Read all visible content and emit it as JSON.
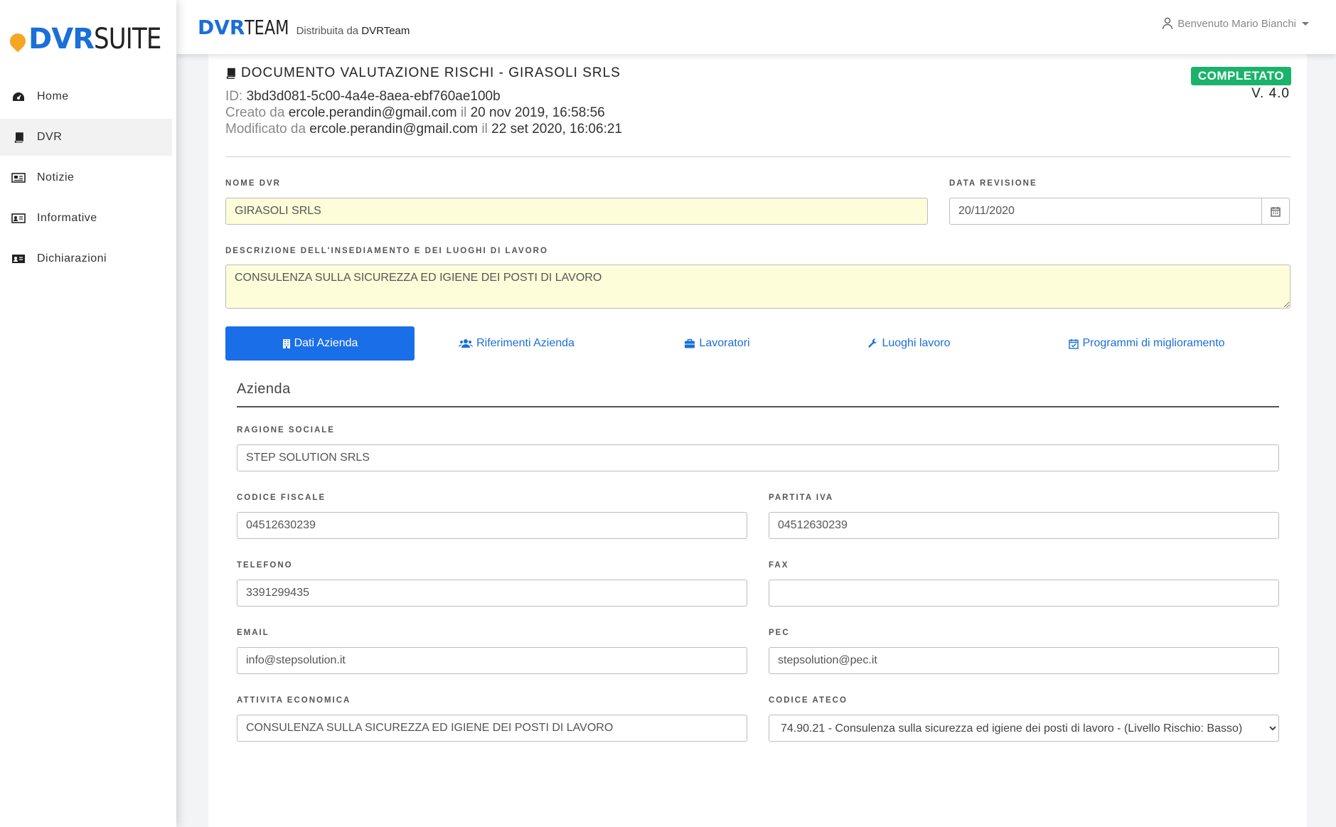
{
  "sidebar": {
    "logo": {
      "dvr": "DVR",
      "suite": "SUITE"
    },
    "items": [
      {
        "label": "Home",
        "icon": "dashboard-icon"
      },
      {
        "label": "DVR",
        "icon": "book-icon",
        "active": true
      },
      {
        "label": "Notizie",
        "icon": "newspaper-icon"
      },
      {
        "label": "Informative",
        "icon": "id-card-icon"
      },
      {
        "label": "Dichiarazioni",
        "icon": "address-card-icon"
      }
    ]
  },
  "topbar": {
    "brand_bold": "DVR",
    "brand_light": "TEAM",
    "distributed_prefix": "Distribuita da",
    "distributed_name": "DVRTeam",
    "user_greeting": "Benvenuto Mario Bianchi"
  },
  "document": {
    "title": "DOCUMENTO VALUTAZIONE RISCHI - GIRASOLI SRLS",
    "id_label": "ID:",
    "id_value": "3bd3d081-5c00-4a4e-8aea-ebf760ae100b",
    "created_label": "Creato da",
    "created_by": "ercole.perandin@gmail.com",
    "created_on_label": "il",
    "created_date": "20 nov 2019, 16:58:56",
    "modified_label": "Modificato da",
    "modified_by": "ercole.perandin@gmail.com",
    "modified_on_label": "il",
    "modified_date": "22 set 2020, 16:06:21",
    "status": "COMPLETATO",
    "version": "V. 4.0"
  },
  "form": {
    "nome_dvr_label": "NOME DVR",
    "nome_dvr_value": "GIRASOLI SRLS",
    "data_revisione_label": "DATA REVISIONE",
    "data_revisione_value": "20/11/2020",
    "descrizione_label": "DESCRIZIONE DELL'INSEDIAMENTO E DEI LUOGHI DI LAVORO",
    "descrizione_value": "CONSULENZA SULLA SICUREZZA ED IGIENE DEI POSTI DI LAVORO"
  },
  "tabs": [
    {
      "label": "Dati Azienda",
      "icon": "building-icon",
      "active": true
    },
    {
      "label": "Riferimenti Azienda",
      "icon": "users-icon"
    },
    {
      "label": "Lavoratori",
      "icon": "briefcase-icon"
    },
    {
      "label": "Luoghi lavoro",
      "icon": "wrench-icon"
    },
    {
      "label": "Programmi di miglioramento",
      "icon": "calendar-check-icon"
    }
  ],
  "azienda": {
    "section_title": "Azienda",
    "ragione_sociale_label": "RAGIONE SOCIALE",
    "ragione_sociale_value": "STEP SOLUTION SRLS",
    "codice_fiscale_label": "CODICE FISCALE",
    "codice_fiscale_value": "04512630239",
    "partita_iva_label": "PARTITA IVA",
    "partita_iva_value": "04512630239",
    "telefono_label": "TELEFONO",
    "telefono_value": "3391299435",
    "fax_label": "FAX",
    "fax_value": "",
    "email_label": "EMAIL",
    "email_value": "info@stepsolution.it",
    "pec_label": "PEC",
    "pec_value": "stepsolution@pec.it",
    "attivita_label": "ATTIVITA ECONOMICA",
    "attivita_value": "CONSULENZA SULLA SICUREZZA ED IGIENE DEI POSTI DI LAVORO",
    "ateco_label": "CODICE ATECO",
    "ateco_value": "74.90.21 - Consulenza sulla sicurezza ed igiene dei posti di lavoro - (Livello Rischio: Basso)"
  },
  "colors": {
    "accent": "#1a6ee8",
    "status_green": "#1bb36b",
    "highlight_yellow": "#fdfdd9",
    "logo_orange": "#f5a623"
  }
}
